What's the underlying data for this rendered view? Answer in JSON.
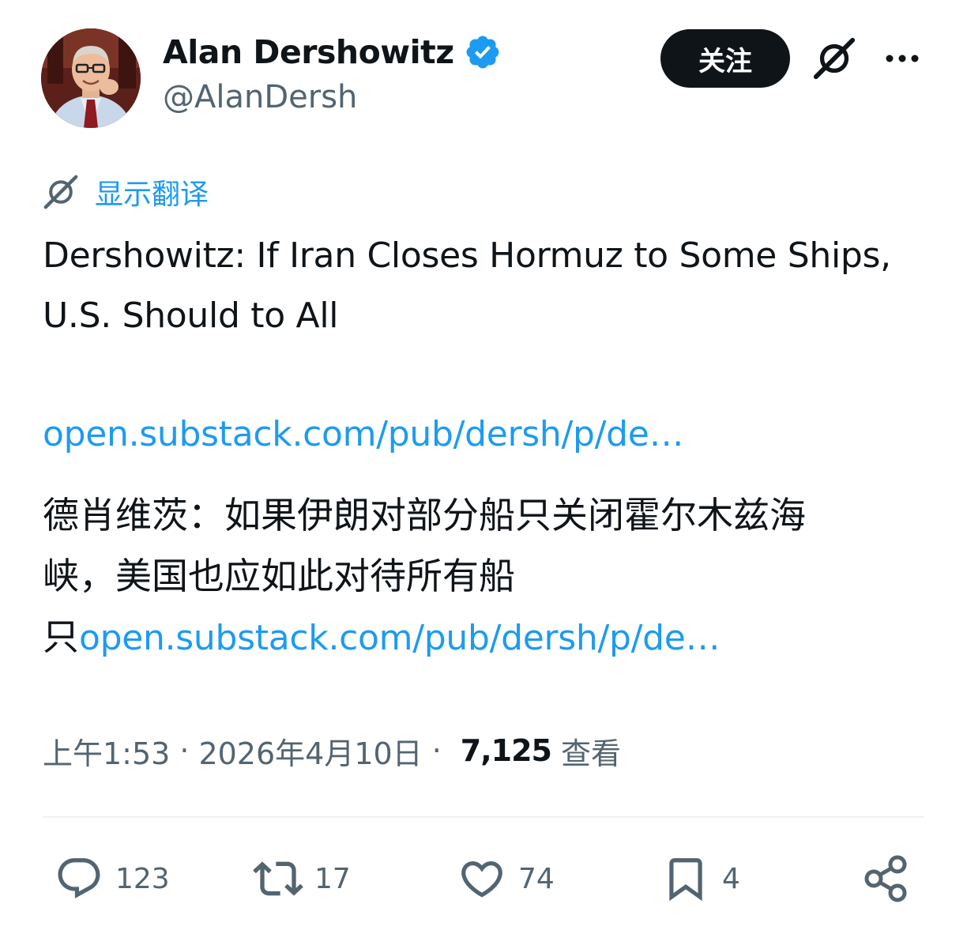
{
  "author": {
    "name": "Alan Dershowitz",
    "handle": "@AlanDersh",
    "verified_color": "#1d9bf0"
  },
  "header": {
    "follow_label": "关注"
  },
  "translate": {
    "label": "显示翻译"
  },
  "tweet": {
    "text": "Dershowitz: If Iran Closes Hormuz to Some Ships, U.S. Should to All",
    "link_text": "open.substack.com/pub/dersh/p/de…"
  },
  "translation": {
    "line1": "德肖维茨：如果伊朗对部分船只关闭霍尔木兹海",
    "line2": "峡，美国也应如此对待所有船",
    "line3_prefix": "只",
    "line3_link": "open.substack.com/pub/dersh/p/de…"
  },
  "meta": {
    "time": "上午1:53",
    "date": "2026年4月10日",
    "separator": "·",
    "views_count": "7,125",
    "views_label": "查看"
  },
  "actions": {
    "replies": "123",
    "reposts": "17",
    "likes": "74",
    "bookmarks": "4"
  },
  "icons": {
    "verified": "verified-badge-icon",
    "grok": "grok-icon",
    "more": "more-icon",
    "reply": "reply-icon",
    "repost": "repost-icon",
    "like": "heart-icon",
    "bookmark": "bookmark-icon",
    "share": "share-icon"
  },
  "colors": {
    "text": "#0f1419",
    "secondary": "#536471",
    "accent": "#1d9bf0",
    "divider": "#eff3f4"
  }
}
